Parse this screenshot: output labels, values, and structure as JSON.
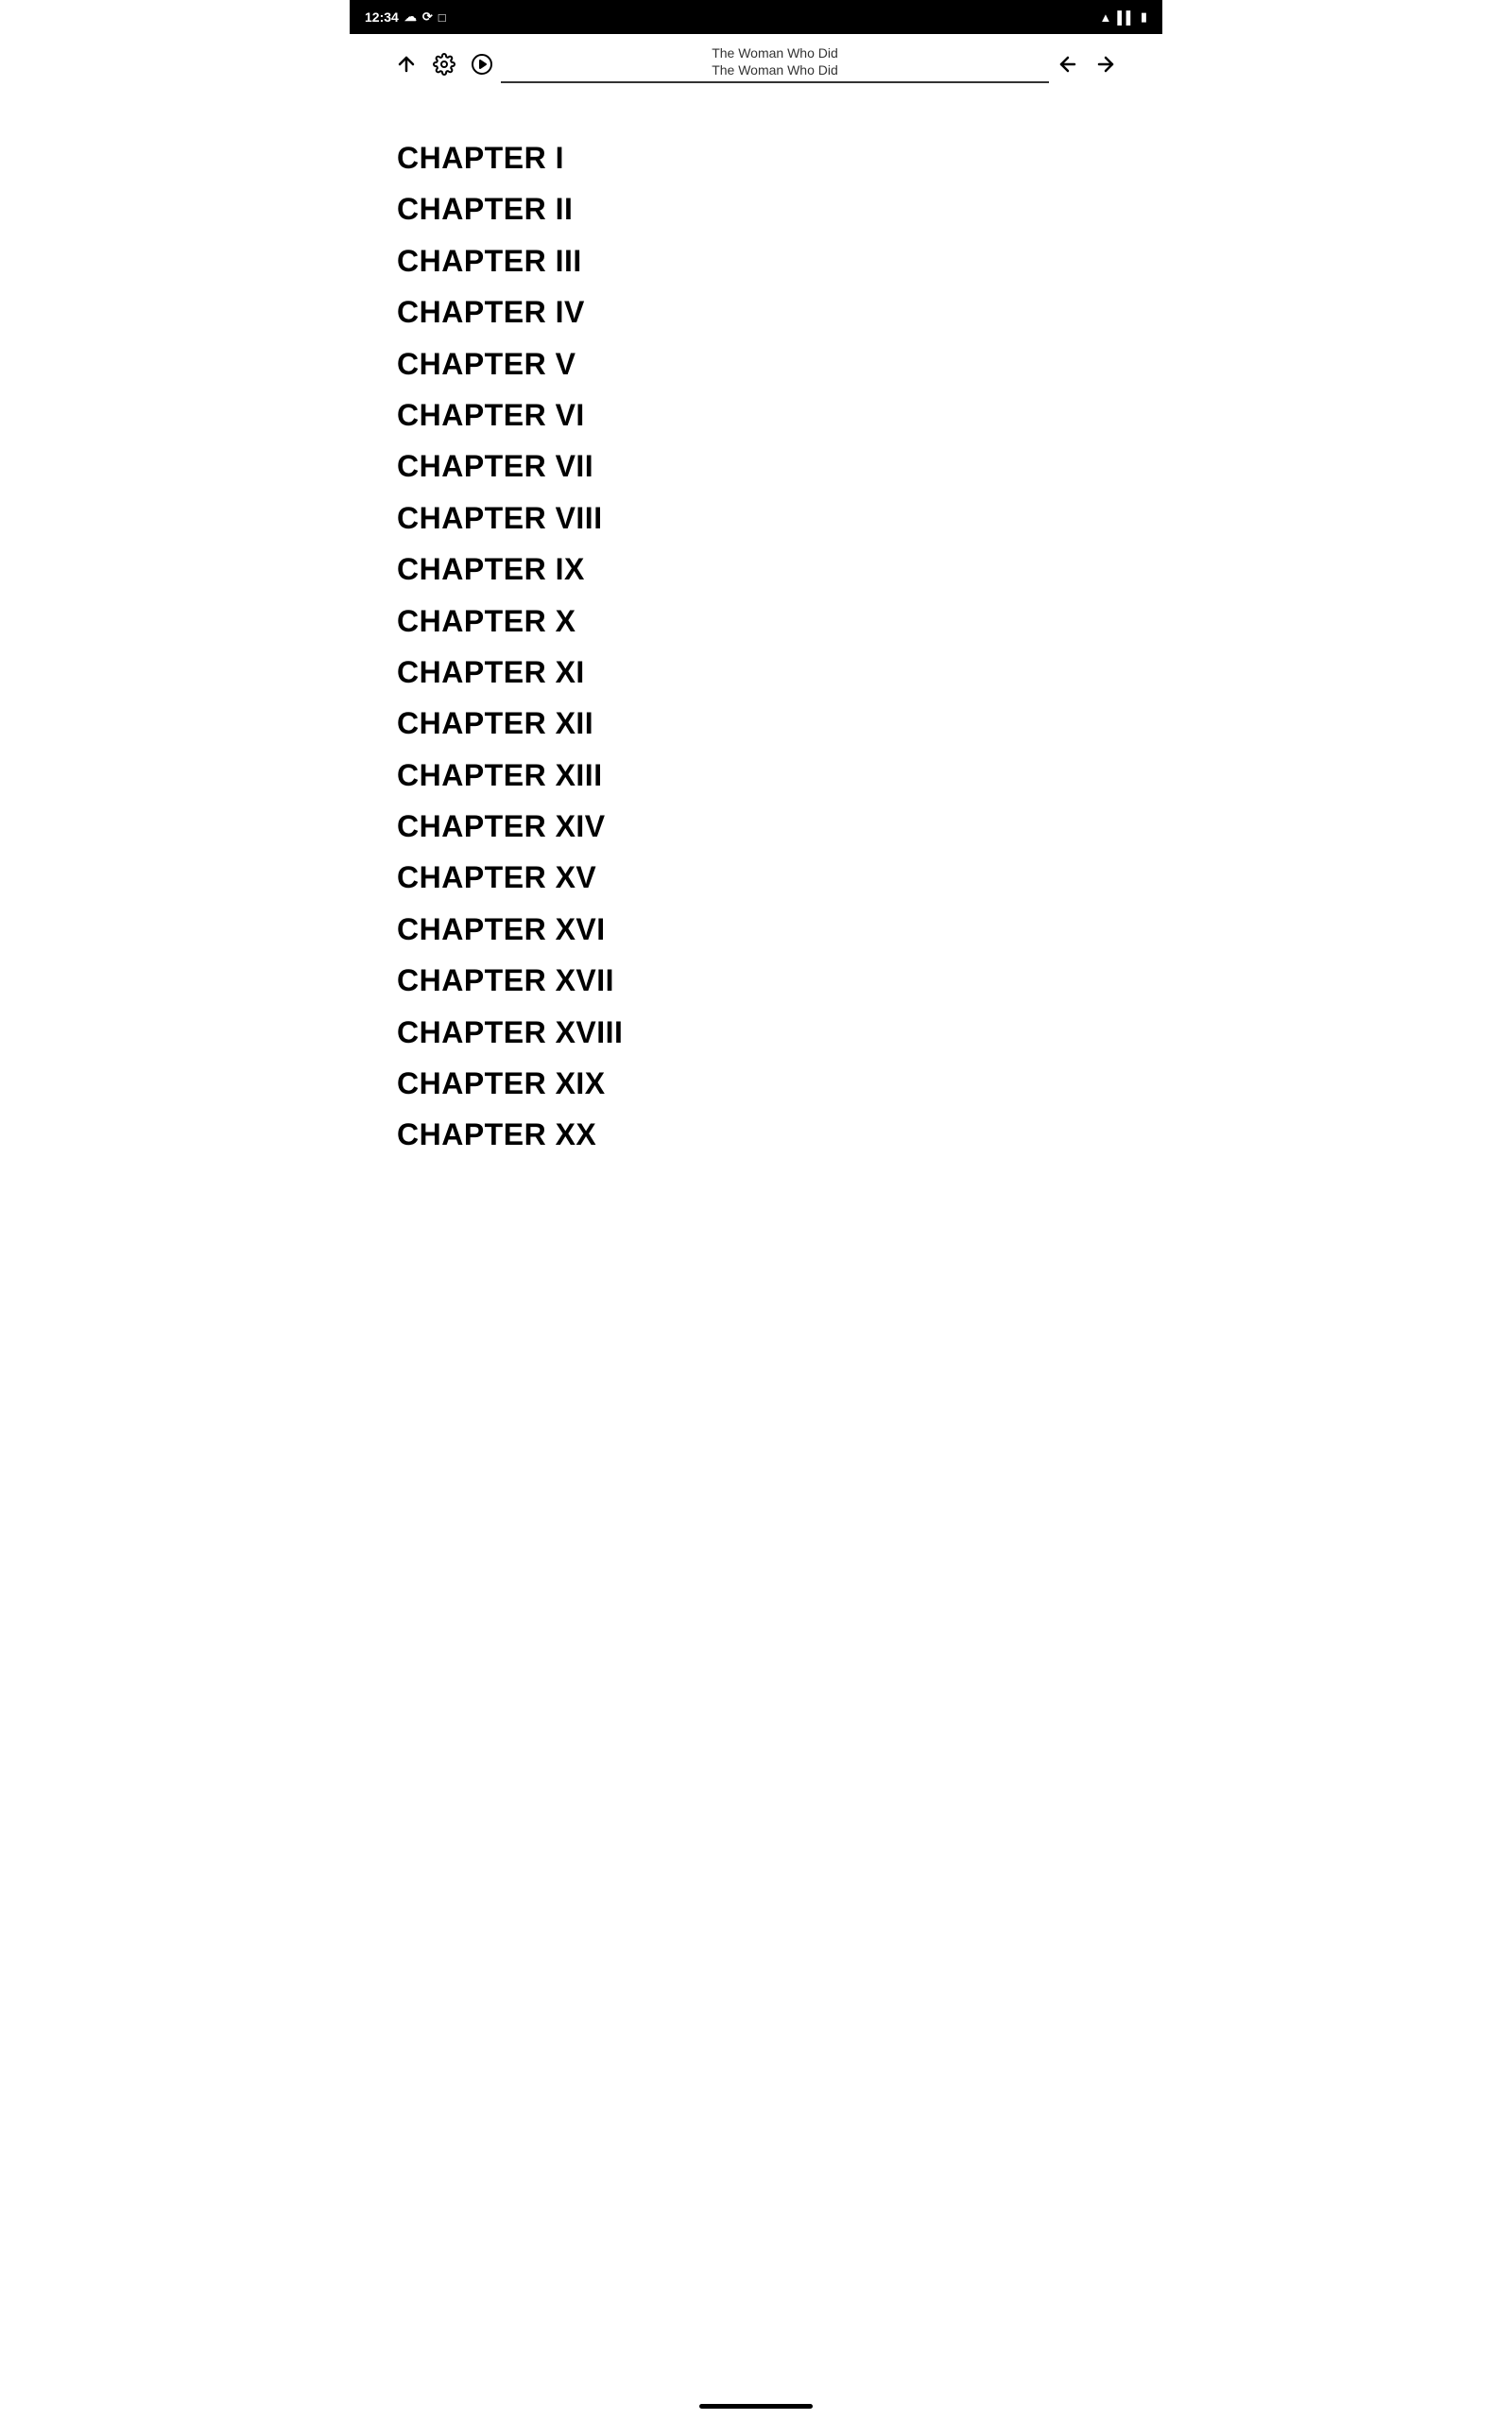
{
  "status_bar": {
    "time": "12:34",
    "icons_right": [
      "wifi",
      "signal",
      "battery"
    ]
  },
  "toolbar": {
    "up_arrow_label": "↑",
    "settings_label": "⚙",
    "play_label": "▶",
    "back_label": "←",
    "forward_label": "→",
    "title_line1": "The Woman Who Did",
    "title_line2": "The Woman Who Did"
  },
  "chapters": [
    {
      "label": "CHAPTER I"
    },
    {
      "label": "CHAPTER II"
    },
    {
      "label": "CHAPTER III"
    },
    {
      "label": "CHAPTER IV"
    },
    {
      "label": "CHAPTER V"
    },
    {
      "label": "CHAPTER VI"
    },
    {
      "label": "CHAPTER VII"
    },
    {
      "label": "CHAPTER VIII"
    },
    {
      "label": "CHAPTER IX"
    },
    {
      "label": "CHAPTER X"
    },
    {
      "label": "CHAPTER XI"
    },
    {
      "label": "CHAPTER XII"
    },
    {
      "label": "CHAPTER XIII"
    },
    {
      "label": "CHAPTER XIV"
    },
    {
      "label": "CHAPTER XV"
    },
    {
      "label": "CHAPTER XVI"
    },
    {
      "label": "CHAPTER XVII"
    },
    {
      "label": "CHAPTER XVIII"
    },
    {
      "label": "CHAPTER XIX"
    },
    {
      "label": "CHAPTER XX"
    }
  ]
}
